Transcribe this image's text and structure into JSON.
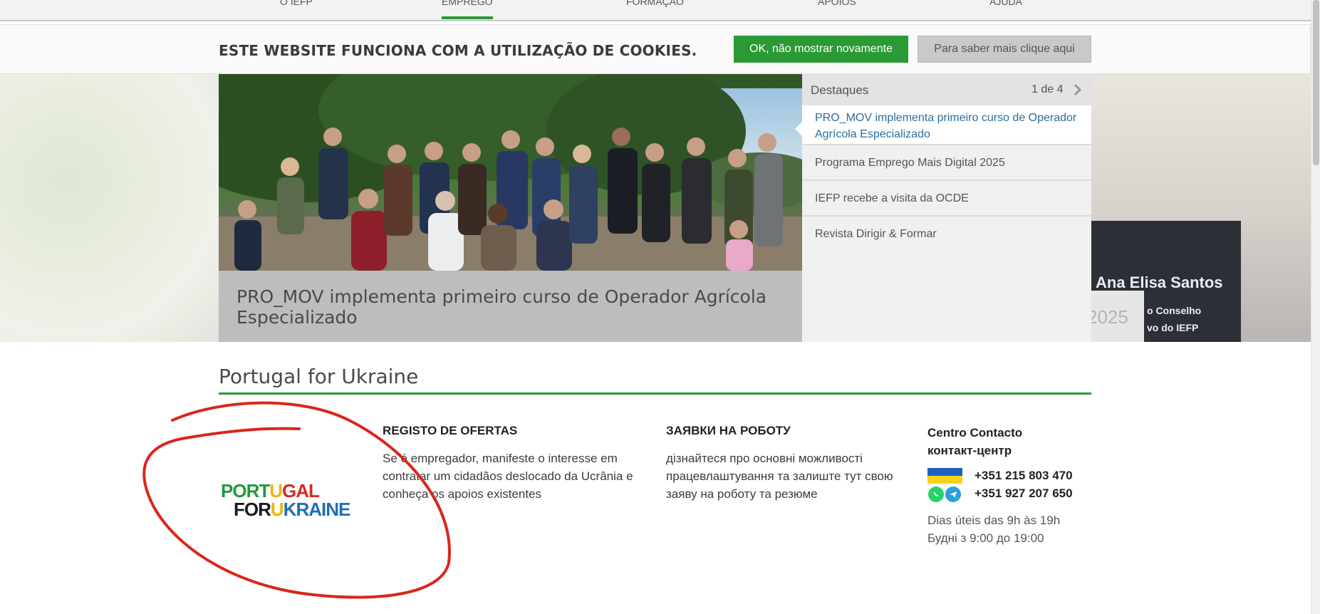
{
  "topnav": {
    "items": [
      {
        "label": "O IEFP"
      },
      {
        "label": "EMPREGO"
      },
      {
        "label": "FORMAÇÃO"
      },
      {
        "label": "APOIOS"
      },
      {
        "label": "AJUDA"
      }
    ]
  },
  "cookie": {
    "message": "ESTE WEBSITE FUNCIONA COM A UTILIZAÇÃO DE COOKIES.",
    "ok_label": "OK, não mostrar novamente",
    "more_label": "Para saber mais clique aqui"
  },
  "hero": {
    "caption": "PRO_MOV implementa primeiro curso de Operador Agrícola Especializado",
    "background_podium_name": "Ana Elisa Santos",
    "background_podium_line1": "o Conselho",
    "background_podium_line2": "vo do IEFP",
    "background_year": "2025"
  },
  "highlights": {
    "title": "Destaques",
    "counter": "1 de 4",
    "next_icon": "chevron-right",
    "items": [
      {
        "label": "PRO_MOV implementa primeiro curso de Operador Agrícola Especializado"
      },
      {
        "label": "Programa Emprego Mais Digital 2025"
      },
      {
        "label": "IEFP recebe a visita da OCDE"
      },
      {
        "label": "Revista Dirigir & Formar"
      }
    ]
  },
  "ukraine": {
    "section_title": "Portugal for Ukraine",
    "logo": {
      "line1_a": "PORT",
      "line1_b": "U",
      "line1_c": "GAL",
      "line2_a": "FOR",
      "line2_b": "U",
      "line2_c": "KRAINE"
    },
    "col1": {
      "title": "REGISTO DE OFERTAS",
      "text": "Se é empregador, manifeste o interesse em contratar um cidadãos deslocado da Ucrânia e conheça os apoios existentes"
    },
    "col2": {
      "title": "ЗАЯВКИ НА РОБОТУ",
      "text": "дізнайтеся про основні можливості працевлаштування та залиште тут свою заяву на роботу та резюме"
    },
    "contact": {
      "title_line1": "Centro Contacto",
      "title_line2": "контакт-центр",
      "phone1": "+351 215 803 470",
      "phone2": "+351 927 207 650",
      "hours_pt": "Dias úteis das 9h às 19h",
      "hours_ua": "Будні з 9:00 до 19:00",
      "icons": [
        "ukraine-flag",
        "whatsapp-icon",
        "telegram-icon"
      ]
    }
  },
  "colors": {
    "brand_green": "#2a9a35",
    "link_blue": "#2c6d9a",
    "annotation_red": "#d9261c"
  }
}
